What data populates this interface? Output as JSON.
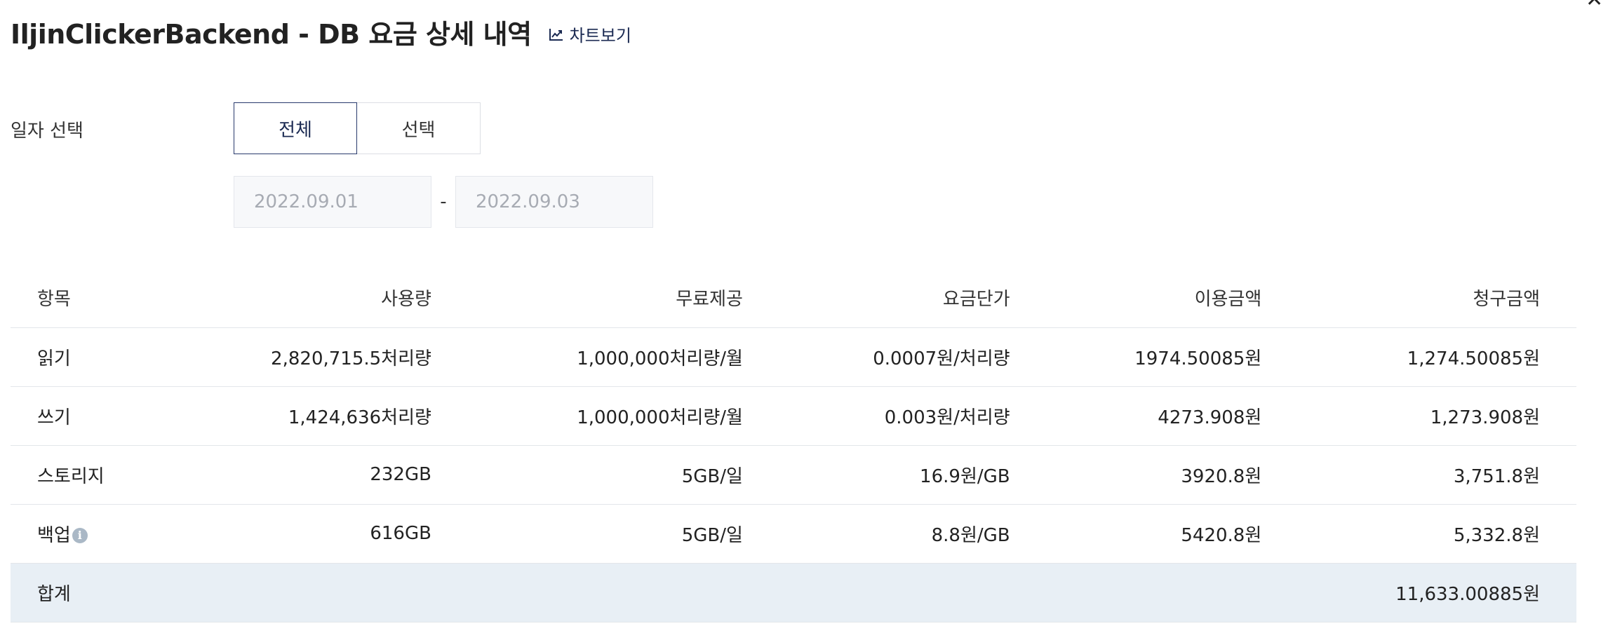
{
  "header": {
    "title": "IljinClickerBackend - DB 요금 상세 내역",
    "chart_link_label": "차트보기"
  },
  "date_filter": {
    "label": "일자 선택",
    "options": [
      "전체",
      "선택"
    ],
    "selected": "전체",
    "start_date": "2022.09.01",
    "end_date": "2022.09.03",
    "separator": "-"
  },
  "table": {
    "columns": [
      "항목",
      "사용량",
      "무료제공",
      "요금단가",
      "이용금액",
      "청구금액"
    ],
    "rows": [
      {
        "item": "읽기",
        "usage": "2,820,715.5처리량",
        "free": "1,000,000처리량/월",
        "unit_price": "0.0007원/처리량",
        "amount": "1974.50085원",
        "billed": "1,274.50085원"
      },
      {
        "item": "쓰기",
        "usage": "1,424,636처리량",
        "free": "1,000,000처리량/월",
        "unit_price": "0.003원/처리량",
        "amount": "4273.908원",
        "billed": "1,273.908원"
      },
      {
        "item": "스토리지",
        "usage": "232GB",
        "free": "5GB/일",
        "unit_price": "16.9원/GB",
        "amount": "3920.8원",
        "billed": "3,751.8원"
      },
      {
        "item": "백업",
        "usage": "616GB",
        "free": "5GB/일",
        "unit_price": "8.8원/GB",
        "amount": "5420.8원",
        "billed": "5,332.8원"
      }
    ],
    "total": {
      "label": "합계",
      "billed": "11,633.00885원"
    }
  },
  "icons": {
    "close": "close-icon",
    "chart": "line-chart-icon",
    "info": "info-icon"
  },
  "colors": {
    "accent": "#283a6c",
    "total_row_bg": "#e8eff5",
    "input_bg": "#f7f8fa"
  }
}
